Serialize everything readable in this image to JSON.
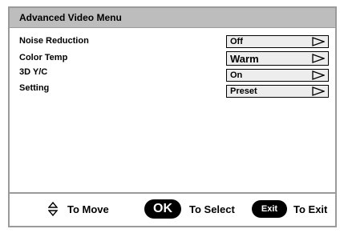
{
  "menu": {
    "title": "Advanced Video Menu",
    "items": [
      {
        "label": "Noise Reduction",
        "value": "Off"
      },
      {
        "label": "Color Temp",
        "value": "Warm"
      },
      {
        "label": "3D Y/C",
        "value": "On"
      },
      {
        "label": "Setting",
        "value": "Preset"
      }
    ]
  },
  "footer": {
    "move_label": "To Move",
    "ok_button": "OK",
    "select_label": "To Select",
    "exit_button": "Exit",
    "exit_label": "To Exit"
  },
  "icons": {
    "navigate": "up-down-arrows-icon",
    "value_arrow": "triangle-right-outline-icon"
  }
}
